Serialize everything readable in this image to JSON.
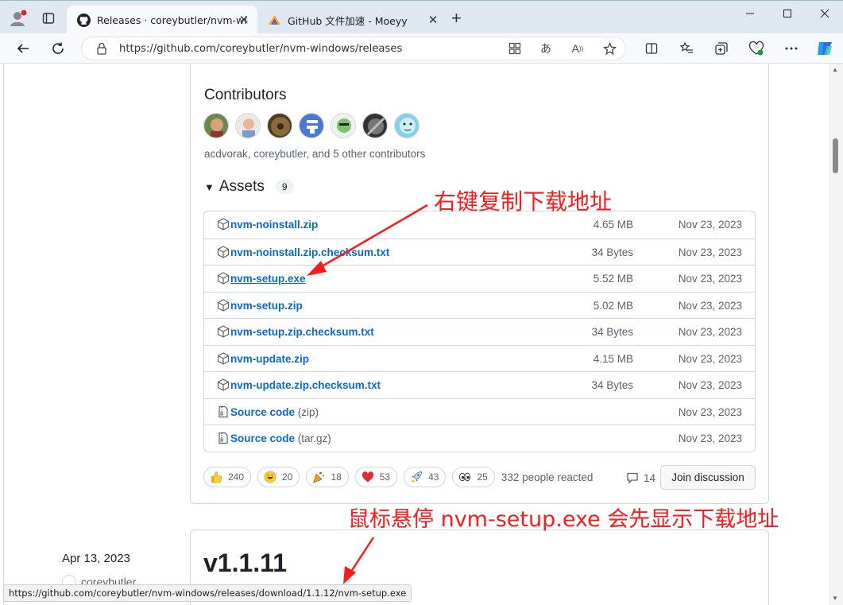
{
  "browser": {
    "tabs": [
      {
        "title": "Releases · coreybutler/nvm-wind",
        "active": true
      },
      {
        "title": "GitHub 文件加速 - Moeyy",
        "active": false
      }
    ],
    "new_tab": "+",
    "url": "https://github.com/coreybutler/nvm-windows/releases",
    "status_url": "https://github.com/coreybutler/nvm-windows/releases/download/1.1.12/nvm-setup.exe"
  },
  "contributors": {
    "heading": "Contributors",
    "text": "acdvorak, coreybutler, and 5 other contributors"
  },
  "assets": {
    "heading": "Assets",
    "count": "9",
    "rows": [
      {
        "name": "nvm-noinstall.zip",
        "sub": "",
        "size": "4.65 MB",
        "date": "Nov 23, 2023"
      },
      {
        "name": "nvm-noinstall.zip.checksum.txt",
        "sub": "",
        "size": "34 Bytes",
        "date": "Nov 23, 2023"
      },
      {
        "name": "nvm-setup.exe",
        "sub": "",
        "size": "5.52 MB",
        "date": "Nov 23, 2023"
      },
      {
        "name": "nvm-setup.zip",
        "sub": "",
        "size": "5.02 MB",
        "date": "Nov 23, 2023"
      },
      {
        "name": "nvm-setup.zip.checksum.txt",
        "sub": "",
        "size": "34 Bytes",
        "date": "Nov 23, 2023"
      },
      {
        "name": "nvm-update.zip",
        "sub": "",
        "size": "4.15 MB",
        "date": "Nov 23, 2023"
      },
      {
        "name": "nvm-update.zip.checksum.txt",
        "sub": "",
        "size": "34 Bytes",
        "date": "Nov 23, 2023"
      },
      {
        "name": "Source code",
        "sub": "(zip)",
        "size": "",
        "date": "Nov 23, 2023"
      },
      {
        "name": "Source code",
        "sub": "(tar.gz)",
        "size": "",
        "date": "Nov 23, 2023"
      }
    ]
  },
  "reactions": {
    "items": [
      {
        "emoji": "thumbs-up",
        "count": "240"
      },
      {
        "emoji": "laugh",
        "count": "20"
      },
      {
        "emoji": "hooray",
        "count": "18"
      },
      {
        "emoji": "heart",
        "count": "53"
      },
      {
        "emoji": "rocket",
        "count": "43"
      },
      {
        "emoji": "eyes",
        "count": "25"
      }
    ],
    "summary": "332 people reacted",
    "comments": "14",
    "join_label": "Join discussion"
  },
  "next_release": {
    "date": "Apr 13, 2023",
    "author": "coreybutler",
    "version": "v1.1.11"
  },
  "annotations": {
    "a1": "右键复制下载地址",
    "a2": "鼠标悬停 nvm-setup.exe 会先显示下载地址",
    "color": "#ff1a1a"
  }
}
